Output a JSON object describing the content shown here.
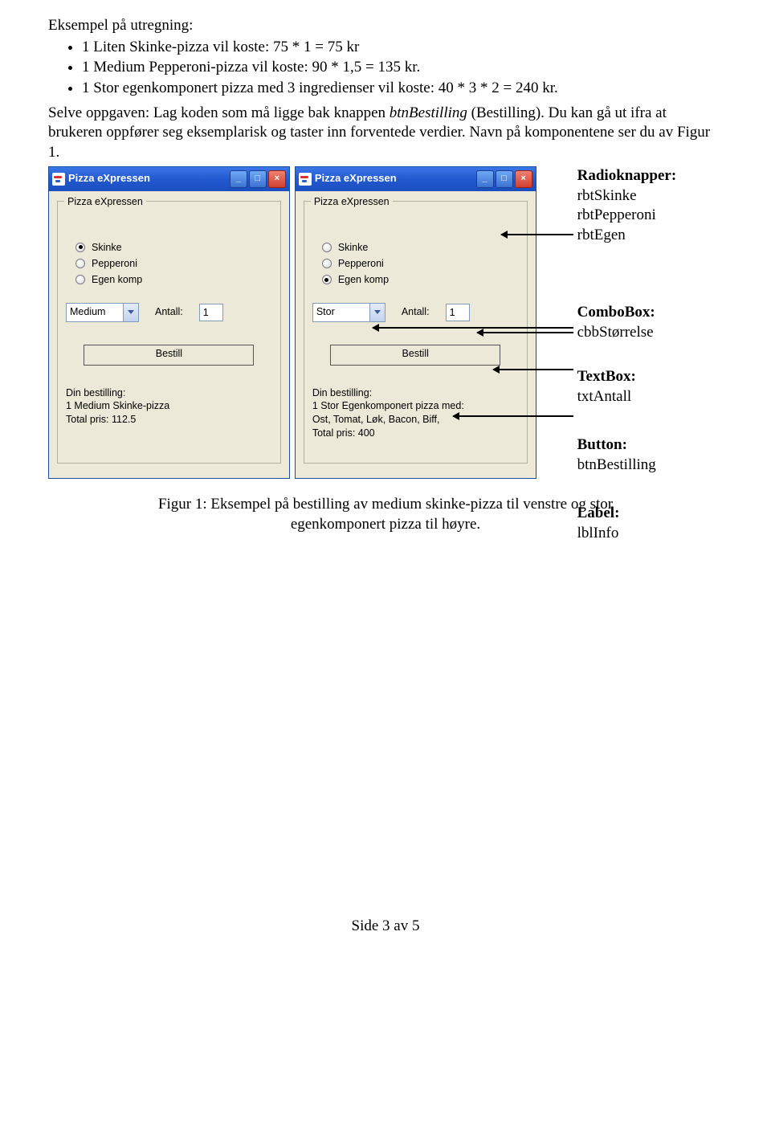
{
  "heading": "Eksempel på utregning:",
  "bullets": [
    "1 Liten Skinke-pizza vil koste: 75 * 1 = 75 kr",
    "1 Medium Pepperoni-pizza vil koste: 90 * 1,5 = 135 kr.",
    "1 Stor egenkomponert pizza med 3 ingredienser vil koste: 40 * 3 * 2 = 240 kr."
  ],
  "para1_a": "Selve oppgaven: Lag koden som må ligge bak knappen ",
  "para1_b": "btnBestilling",
  "para1_c": " (Bestilling). Du kan gå ut ifra at brukeren oppfører seg eksemplarisk og taster inn forventede verdier. Navn på komponentene ser du av Figur 1.",
  "window_title": "Pizza eXpressen",
  "group_label": "Pizza eXpressen",
  "radios": [
    "Skinke",
    "Pepperoni",
    "Egen komp"
  ],
  "left": {
    "selected": 0,
    "size": "Medium",
    "antall_label": "Antall:",
    "antall": "1",
    "btn": "Bestill",
    "out1": "Din bestilling:",
    "out2": "1 Medium Skinke-pizza",
    "out3": "Total pris: 112.5",
    "out4": ""
  },
  "right": {
    "selected": 2,
    "size": "Stor",
    "antall_label": "Antall:",
    "antall": "1",
    "btn": "Bestill",
    "out1": "Din bestilling:",
    "out2": "1 Stor Egenkomponert pizza med:",
    "out3": "Ost, Tomat, Løk, Bacon, Biff,",
    "out4": "Total pris: 400"
  },
  "annotations": {
    "radio": {
      "title": "Radioknapper:",
      "lines": [
        "rbtSkinke",
        "rbtPepperoni",
        "rbtEgen"
      ]
    },
    "combo": {
      "title": "ComboBox:",
      "lines": [
        "cbbStørrelse"
      ]
    },
    "textbox": {
      "title": "TextBox:",
      "lines": [
        "txtAntall"
      ]
    },
    "button": {
      "title": "Button:",
      "lines": [
        "btnBestilling"
      ]
    },
    "label": {
      "title": "Label:",
      "lines": [
        "lblInfo"
      ]
    }
  },
  "caption": "Figur 1: Eksempel på bestilling av medium skinke-pizza til venstre og stor egenkomponert pizza til høyre.",
  "footer": "Side 3 av 5"
}
